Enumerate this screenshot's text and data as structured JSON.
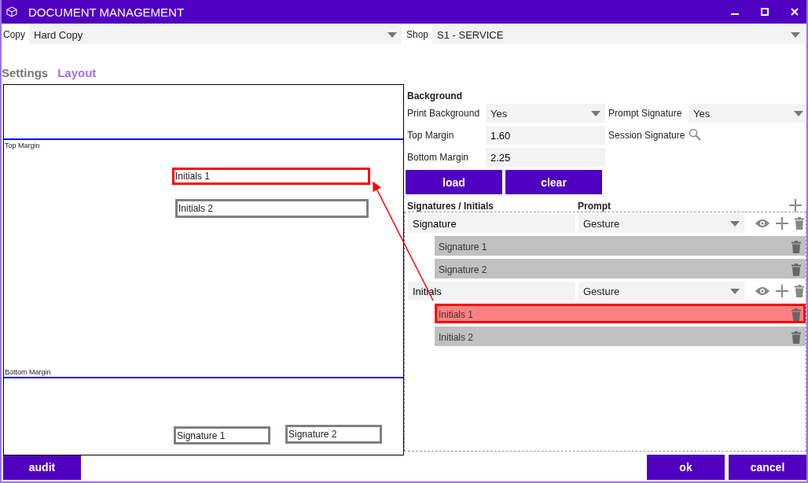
{
  "window": {
    "title": "DOCUMENT MANAGEMENT"
  },
  "copy": {
    "label": "Copy",
    "value": "Hard Copy"
  },
  "shop": {
    "label": "Shop",
    "value": "S1 - SERVICE"
  },
  "tabs": [
    {
      "label": "Settings",
      "selected": false
    },
    {
      "label": "Layout",
      "selected": true
    }
  ],
  "canvas": {
    "top_margin_label": "Top Margin",
    "bottom_margin_label": "Bottom Margin",
    "fields": [
      {
        "label": "Initials 1",
        "selected": true
      },
      {
        "label": "Initials 2",
        "selected": false
      },
      {
        "label": "Signature 1",
        "selected": false
      },
      {
        "label": "Signature 2",
        "selected": false
      }
    ]
  },
  "background": {
    "heading": "Background",
    "print_background": {
      "label": "Print Background",
      "value": "Yes"
    },
    "prompt_signature": {
      "label": "Prompt Signature",
      "value": "Yes"
    },
    "top_margin": {
      "label": "Top Margin",
      "value": "1.60"
    },
    "session_signature": {
      "label": "Session Signature"
    },
    "bottom_margin": {
      "label": "Bottom Margin",
      "value": "2.25"
    },
    "buttons": [
      "load",
      "clear"
    ]
  },
  "signatures": {
    "heading": "Signatures / Initials",
    "prompt_heading": "Prompt",
    "groups": [
      {
        "name": "Signature",
        "prompt": "Gesture",
        "children": [
          {
            "label": "Signature 1",
            "selected": false
          },
          {
            "label": "Signature 2",
            "selected": false
          }
        ]
      },
      {
        "name": "Initials",
        "prompt": "Gesture",
        "children": [
          {
            "label": "Initials 1",
            "selected": true
          },
          {
            "label": "Initials 2",
            "selected": false
          }
        ]
      }
    ]
  },
  "footer": {
    "left_buttons": [
      "audit"
    ],
    "right_buttons": [
      "ok",
      "cancel"
    ]
  }
}
